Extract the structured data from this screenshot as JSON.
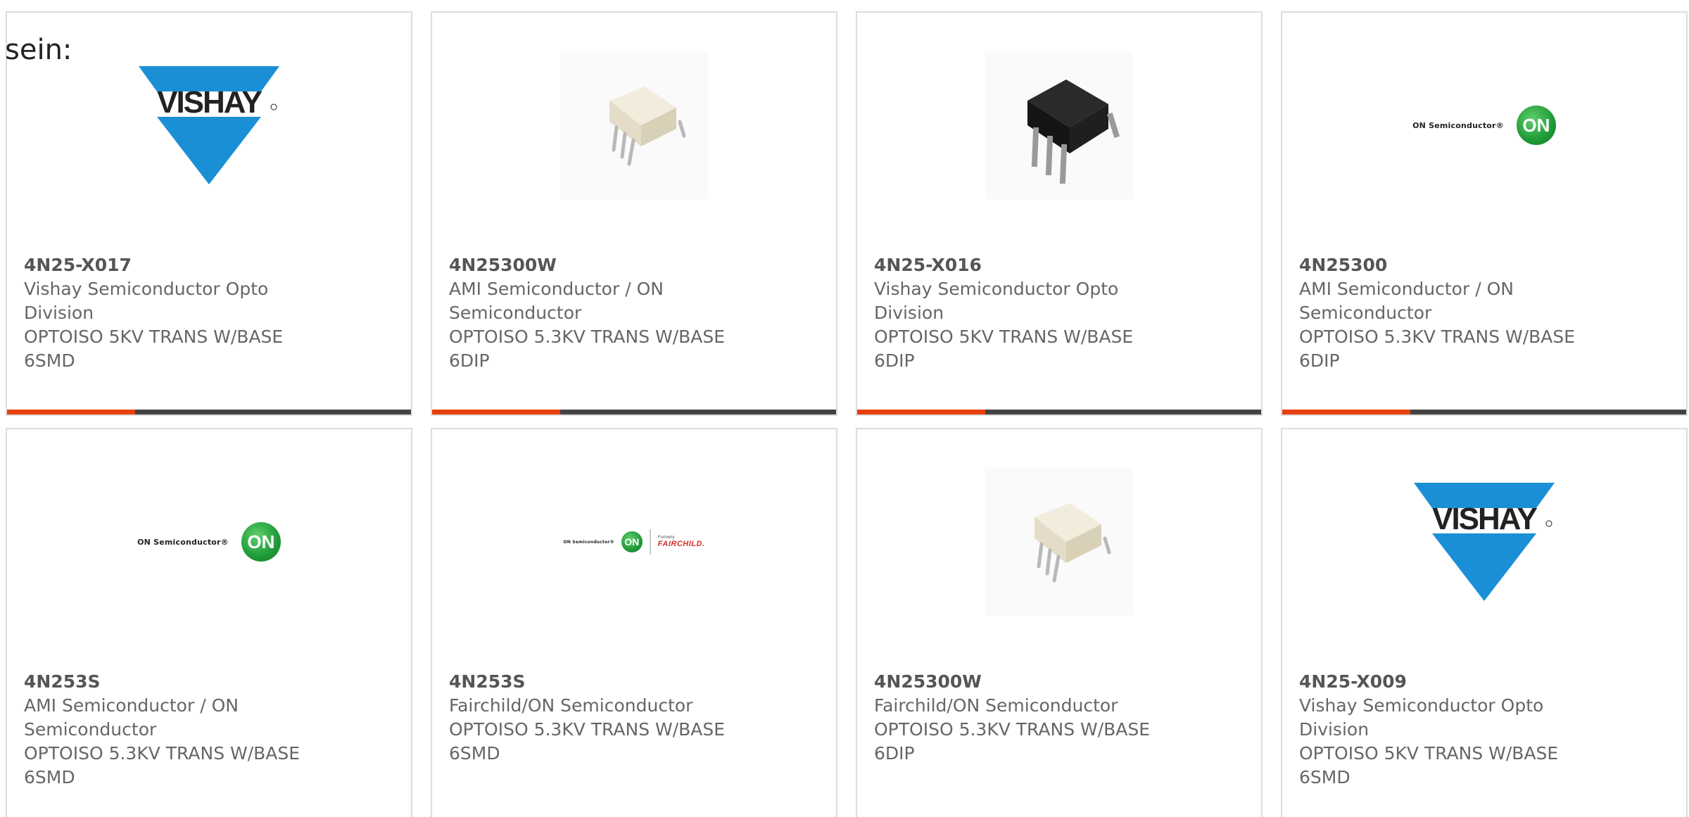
{
  "intro_text": "sein:",
  "products": [
    {
      "part_number": "4N25-X017",
      "manufacturer_lines": [
        "Vishay Semiconductor Opto",
        "Division"
      ],
      "description_lines": [
        "OPTOISO 5KV TRANS W/BASE",
        "6SMD"
      ],
      "image": "vishay-logo"
    },
    {
      "part_number": "4N25300W",
      "manufacturer_lines": [
        "AMI Semiconductor / ON",
        "Semiconductor"
      ],
      "description_lines": [
        "OPTOISO 5.3KV TRANS W/BASE",
        "6DIP"
      ],
      "image": "white-dip6-chip"
    },
    {
      "part_number": "4N25-X016",
      "manufacturer_lines": [
        "Vishay Semiconductor Opto",
        "Division"
      ],
      "description_lines": [
        "OPTOISO 5KV TRANS W/BASE",
        "6DIP"
      ],
      "image": "black-dip6-chip"
    },
    {
      "part_number": "4N25300",
      "manufacturer_lines": [
        "AMI Semiconductor / ON",
        "Semiconductor"
      ],
      "description_lines": [
        "OPTOISO 5.3KV TRANS W/BASE",
        "6DIP"
      ],
      "image": "onsemi-logo",
      "logo_text": "ON Semiconductor®",
      "logo_badge": "ON"
    },
    {
      "part_number": "4N253S",
      "manufacturer_lines": [
        "AMI Semiconductor / ON",
        "Semiconductor"
      ],
      "description_lines": [
        "OPTOISO 5.3KV TRANS W/BASE",
        "6SMD"
      ],
      "image": "onsemi-logo",
      "logo_text": "ON Semiconductor®",
      "logo_badge": "ON"
    },
    {
      "part_number": "4N253S",
      "manufacturer_lines": [
        "Fairchild/ON Semiconductor"
      ],
      "description_lines": [
        "OPTOISO 5.3KV TRANS W/BASE",
        "6SMD"
      ],
      "image": "onsemi-fairchild-logo",
      "logo_text": "ON Semiconductor®",
      "logo_badge": "ON",
      "logo_formerly": "Formerly",
      "logo_fairchild": "FAIRCHILD."
    },
    {
      "part_number": "4N25300W",
      "manufacturer_lines": [
        "Fairchild/ON Semiconductor"
      ],
      "description_lines": [
        "OPTOISO 5.3KV TRANS W/BASE",
        "6DIP"
      ],
      "image": "white-dip6-chip"
    },
    {
      "part_number": "4N25-X009",
      "manufacturer_lines": [
        "Vishay Semiconductor Opto",
        "Division"
      ],
      "description_lines": [
        "OPTOISO 5KV TRANS W/BASE",
        "6SMD"
      ],
      "image": "vishay-logo"
    }
  ],
  "colors": {
    "accent_bar": "#e8400c",
    "bar_base": "#444444",
    "card_border": "#dddddd",
    "text": "#666666"
  }
}
